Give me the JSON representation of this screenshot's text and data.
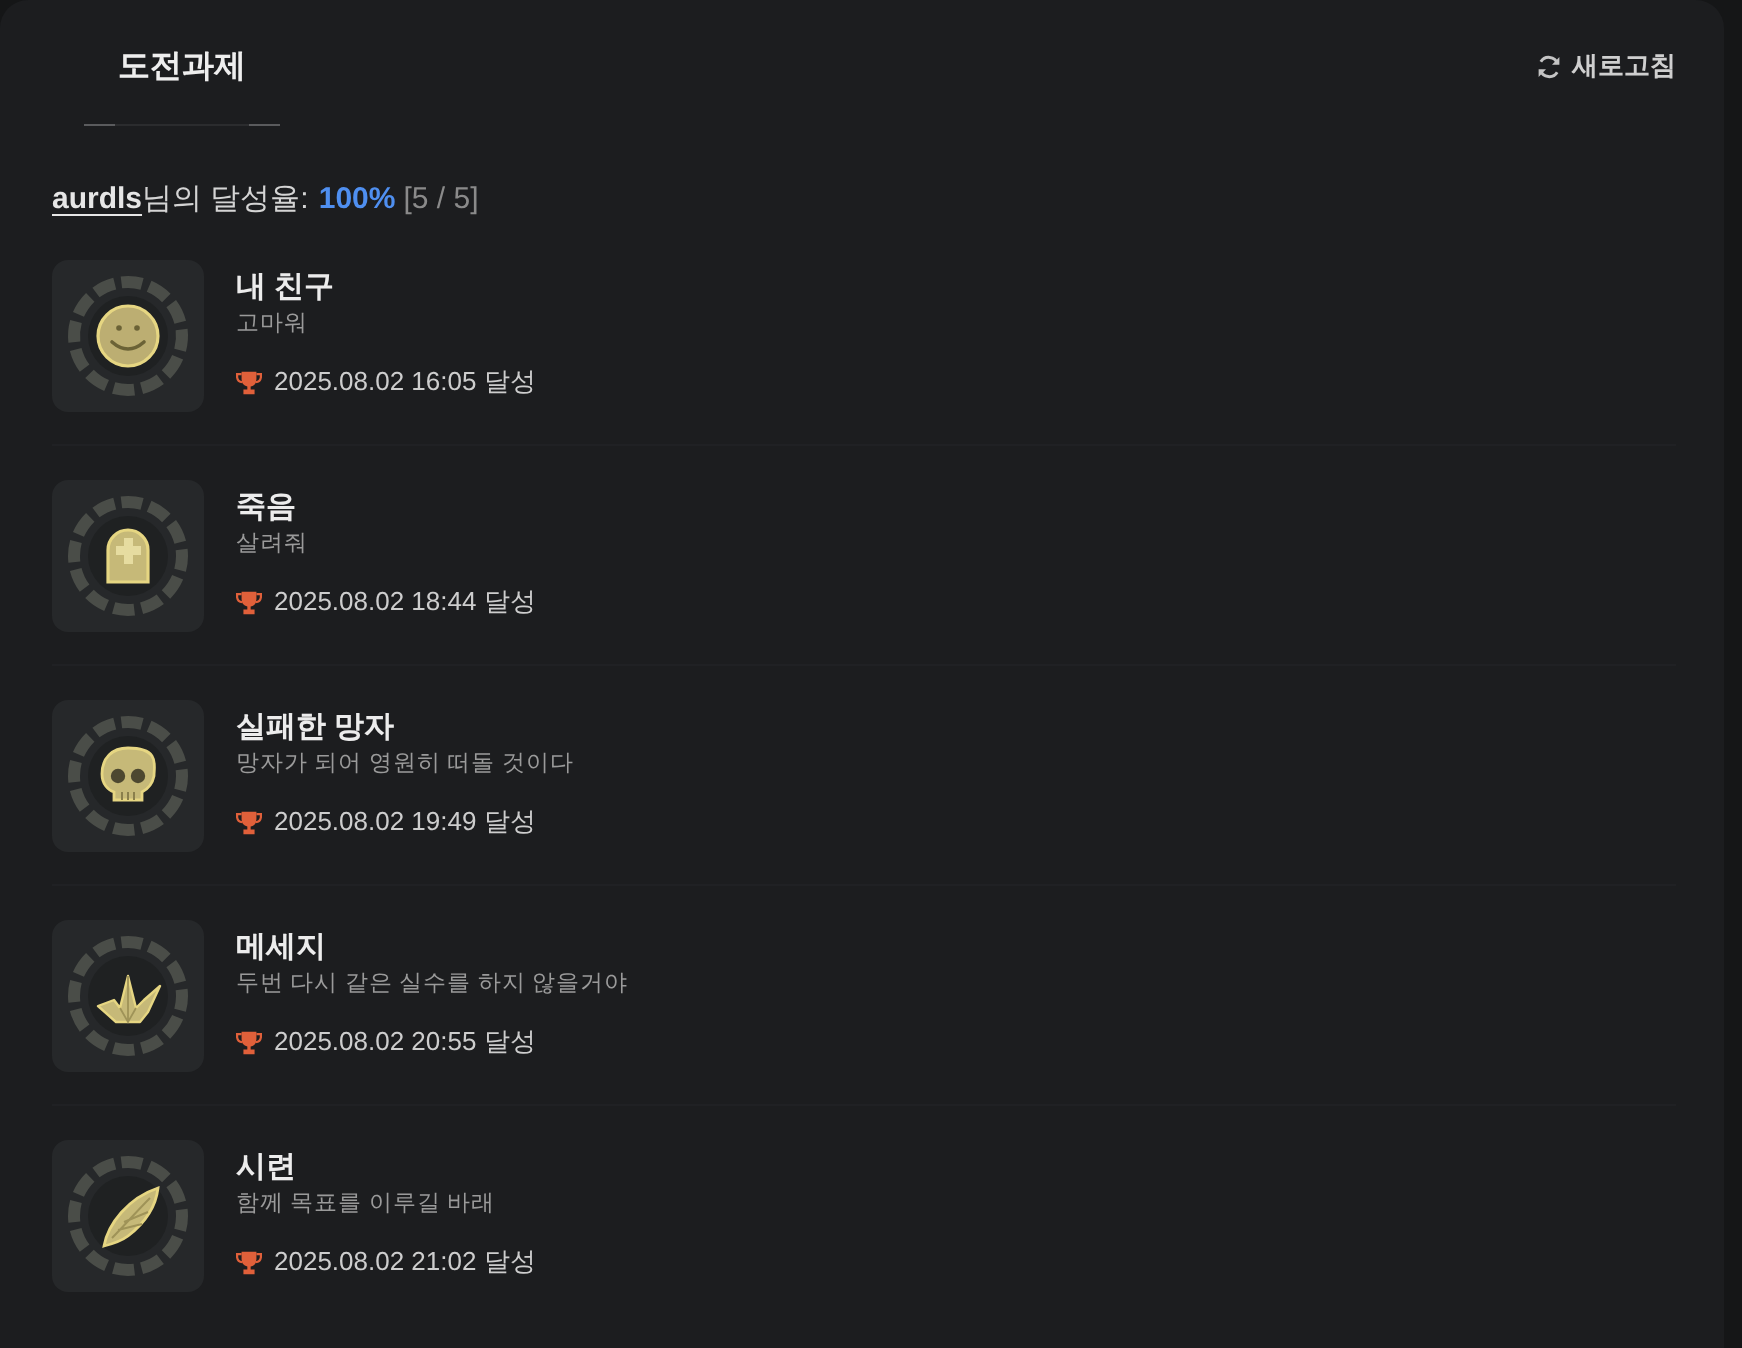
{
  "tabs": [
    {
      "label": "도전과제",
      "selected": true
    }
  ],
  "refresh_button": {
    "label": "새로고침"
  },
  "summary": {
    "username": "aurdls",
    "label": "님의 달성율:",
    "percent": "100%",
    "count": "[5 / 5]"
  },
  "achievements": [
    {
      "kind": "smile",
      "title": "내 친구",
      "description": "고마워",
      "achieved": "2025.08.02 16:05 달성"
    },
    {
      "kind": "tombstone",
      "title": "죽음",
      "description": "살려줘",
      "achieved": "2025.08.02 18:44 달성"
    },
    {
      "kind": "skull",
      "title": "실패한 망자",
      "description": "망자가 되어 영원히 떠돌 것이다",
      "achieved": "2025.08.02 19:49 달성"
    },
    {
      "kind": "crane",
      "title": "메세지",
      "description": "두번 다시 같은 실수를 하지 않을거야",
      "achieved": "2025.08.02 20:55 달성"
    },
    {
      "kind": "wing",
      "title": "시련",
      "description": "함께 목표를 이루길 바래",
      "achieved": "2025.08.02 21:02 달성"
    }
  ]
}
